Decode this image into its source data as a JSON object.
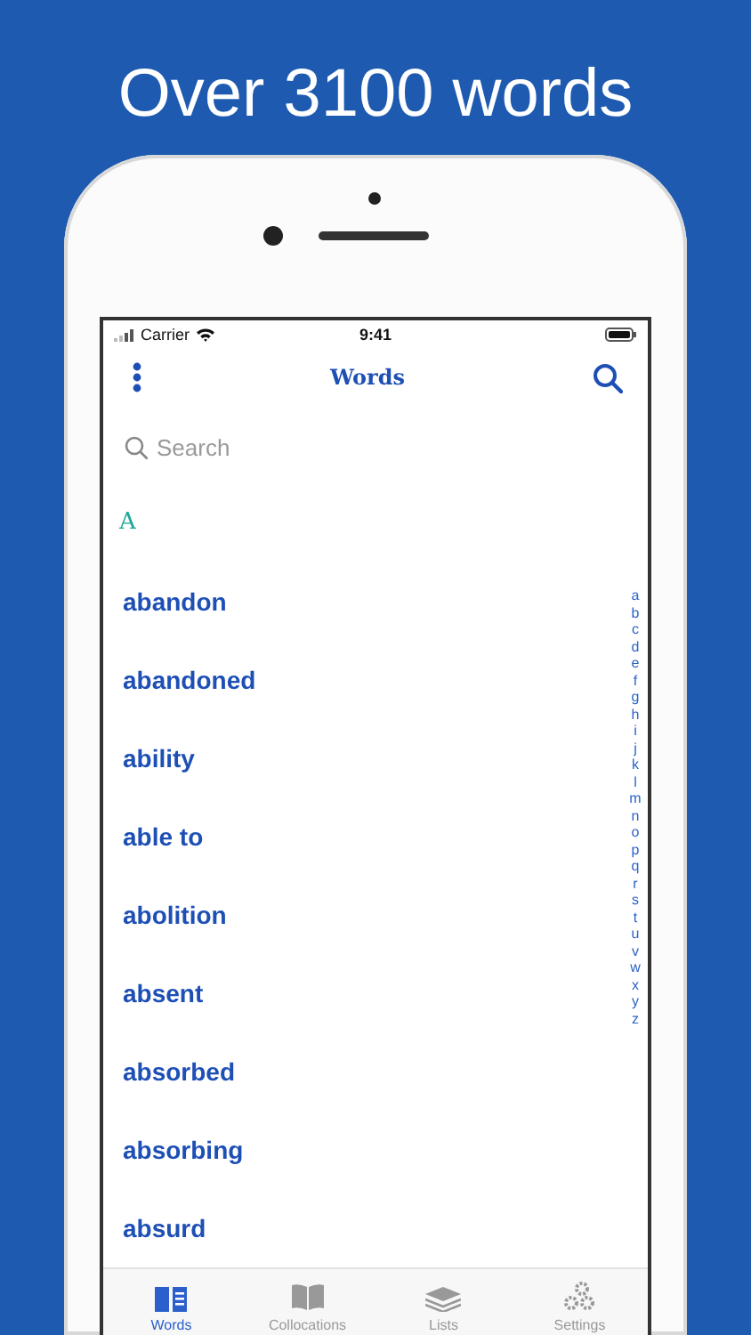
{
  "headline": "Over 3100 words",
  "status_bar": {
    "carrier": "Carrier",
    "time": "9:41"
  },
  "nav": {
    "title": "Words"
  },
  "search": {
    "placeholder": "Search"
  },
  "section": "A",
  "words": [
    "abandon",
    "abandoned",
    "ability",
    "able to",
    "abolition",
    "absent",
    "absorbed",
    "absorbing",
    "absurd"
  ],
  "index": [
    "a",
    "b",
    "c",
    "d",
    "e",
    "f",
    "g",
    "h",
    "i",
    "j",
    "k",
    "l",
    "m",
    "n",
    "o",
    "p",
    "q",
    "r",
    "s",
    "t",
    "u",
    "v",
    "w",
    "x",
    "y",
    "z"
  ],
  "tabs": [
    {
      "label": "Words",
      "kind": "book",
      "selected": true
    },
    {
      "label": "Collocations",
      "kind": "open-book",
      "selected": false
    },
    {
      "label": "Lists",
      "kind": "stack",
      "selected": false
    },
    {
      "label": "Settings",
      "kind": "gears",
      "selected": false
    }
  ]
}
